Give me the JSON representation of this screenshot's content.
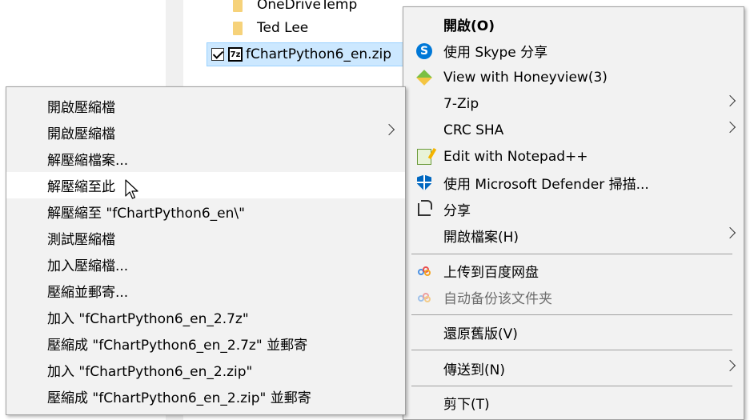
{
  "explorer": {
    "files": [
      {
        "name": "OneDriveTemp",
        "type": "folder"
      },
      {
        "name": "Ted Lee",
        "type": "folder"
      }
    ],
    "selected_file": {
      "name": "fChartPython6_en.zip",
      "icon_text": "7z"
    }
  },
  "context_menu": {
    "items": [
      {
        "label": "開啟(O)",
        "icon": "none"
      },
      {
        "label": "使用 Skype 分享",
        "icon": "skype-icon"
      },
      {
        "label": "View with Honeyview(3)",
        "icon": "honeyview-icon"
      },
      {
        "label": "7-Zip",
        "icon": "none"
      },
      {
        "label": "CRC SHA",
        "icon": "none"
      },
      {
        "label": "Edit with Notepad++",
        "icon": "notepad-plus-plus-icon"
      },
      {
        "label": "使用 Microsoft Defender 掃描...",
        "icon": "defender-shield-icon"
      },
      {
        "label": "分享",
        "icon": "share-icon"
      },
      {
        "label": "開啟檔案(H)",
        "icon": "none"
      },
      {
        "label": "上传到百度网盘",
        "icon": "baidu-netdisk-icon"
      },
      {
        "label": "自动备份该文件夹",
        "icon": "baidu-netdisk-icon"
      },
      {
        "label": "還原舊版(V)",
        "icon": "none"
      },
      {
        "label": "傳送到(N)",
        "icon": "none"
      },
      {
        "label": "剪下(T)",
        "icon": "none"
      }
    ]
  },
  "zip_submenu": {
    "items": [
      {
        "label": "開啟壓縮檔"
      },
      {
        "label": "開啟壓縮檔"
      },
      {
        "label": "解壓縮檔案..."
      },
      {
        "label": "解壓縮至此"
      },
      {
        "label": "解壓縮至 \"fChartPython6_en\\\""
      },
      {
        "label": "測試壓縮檔"
      },
      {
        "label": "加入壓縮檔..."
      },
      {
        "label": "壓縮並郵寄..."
      },
      {
        "label": "加入 \"fChartPython6_en_2.7z\""
      },
      {
        "label": "壓縮成 \"fChartPython6_en_2.7z\" 並郵寄"
      },
      {
        "label": "加入 \"fChartPython6_en_2.zip\""
      },
      {
        "label": "壓縮成 \"fChartPython6_en_2.zip\" 並郵寄"
      }
    ]
  },
  "colors": {
    "menu_bg": "#f2f2f2",
    "highlight_bg": "#ffffff",
    "selection_bg": "#cce8ff",
    "disabled_text": "#6d6d6d"
  }
}
